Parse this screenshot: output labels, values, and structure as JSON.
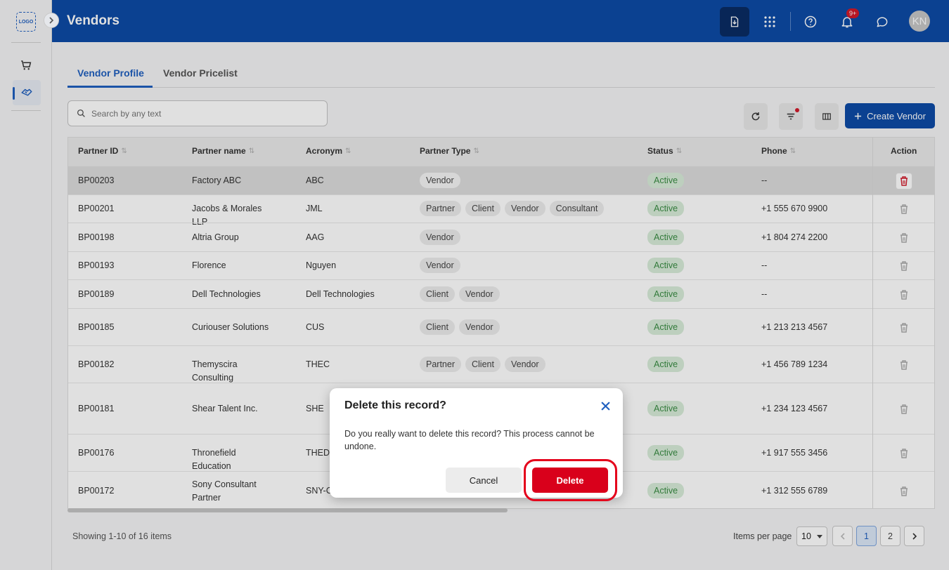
{
  "app": {
    "logo_text": "LOGO"
  },
  "header": {
    "title": "Vendors",
    "notification_badge": "9+",
    "avatar_initials": "KN"
  },
  "tabs": [
    {
      "label": "Vendor Profile",
      "active": true
    },
    {
      "label": "Vendor Pricelist",
      "active": false
    }
  ],
  "toolbar": {
    "search_placeholder": "Search by any text",
    "create_label": "Create Vendor"
  },
  "table": {
    "columns": [
      "Partner ID",
      "Partner name",
      "Acronym",
      "Partner Type",
      "Status",
      "Phone",
      "Action"
    ],
    "rows": [
      {
        "id": "BP00203",
        "name": "Factory ABC",
        "acronym": "ABC",
        "types": [
          "Vendor"
        ],
        "status": "Active",
        "phone": "--",
        "selected": true
      },
      {
        "id": "BP00201",
        "name": "Jacobs & Morales LLP",
        "acronym": "JML",
        "types": [
          "Partner",
          "Client",
          "Vendor",
          "Consultant"
        ],
        "status": "Active",
        "phone": "+1 555 670 9900"
      },
      {
        "id": "BP00198",
        "name": "Altria Group",
        "acronym": "AAG",
        "types": [
          "Vendor"
        ],
        "status": "Active",
        "phone": "+1 804 274 2200"
      },
      {
        "id": "BP00193",
        "name": "Florence",
        "acronym": "Nguyen",
        "types": [
          "Vendor"
        ],
        "status": "Active",
        "phone": "--"
      },
      {
        "id": "BP00189",
        "name": "Dell Technologies",
        "acronym": "Dell Technologies",
        "types": [
          "Client",
          "Vendor"
        ],
        "status": "Active",
        "phone": "--"
      },
      {
        "id": "BP00185",
        "name": "Curiouser Solutions",
        "acronym": "CUS",
        "types": [
          "Client",
          "Vendor"
        ],
        "status": "Active",
        "phone": "+1 213 213 4567"
      },
      {
        "id": "BP00182",
        "name": "Themyscira Consulting",
        "acronym": "THEC",
        "types": [
          "Partner",
          "Client",
          "Vendor"
        ],
        "status": "Active",
        "phone": "+1 456 789 1234"
      },
      {
        "id": "BP00181",
        "name": "Shear Talent Inc.",
        "acronym": "SHE",
        "types": [],
        "status": "Active",
        "phone": "+1 234 123 4567"
      },
      {
        "id": "BP00176",
        "name": "Thronefield Education",
        "acronym": "THEDU",
        "types": [],
        "status": "Active",
        "phone": "+1 917 555 3456"
      },
      {
        "id": "BP00172",
        "name": "Sony Consultant Partner",
        "acronym": "SNY-C",
        "types": [],
        "status": "Active",
        "phone": "+1 312 555 6789"
      }
    ]
  },
  "footer": {
    "showing": "Showing 1-10 of 16 items",
    "items_per_page_label": "Items per page",
    "items_per_page": "10",
    "pages": [
      "1",
      "2"
    ],
    "current_page": "1"
  },
  "dialog": {
    "title": "Delete this record?",
    "message": "Do you really want to delete this record? This process cannot be undone.",
    "cancel_label": "Cancel",
    "delete_label": "Delete"
  },
  "colors": {
    "brand": "#0d4aa5",
    "danger": "#d9001b",
    "status_active_bg": "#d8ecd9",
    "status_active_text": "#3a8c44"
  }
}
